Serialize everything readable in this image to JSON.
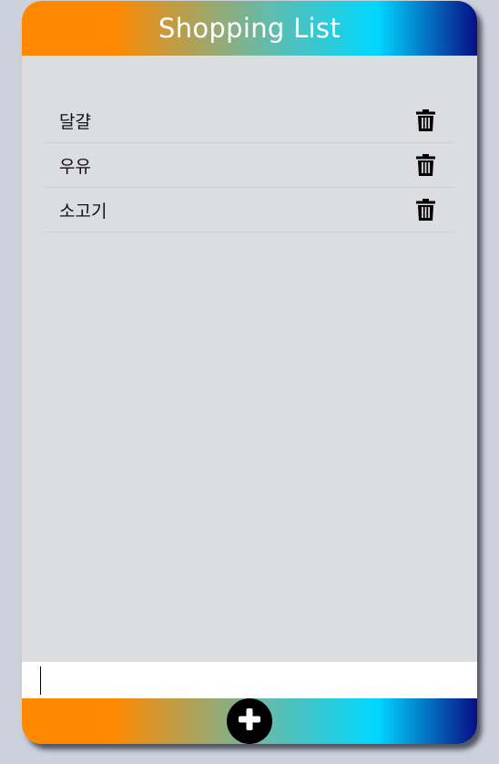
{
  "header": {
    "title": "Shopping List"
  },
  "items": [
    {
      "label": "달걀"
    },
    {
      "label": "우유"
    },
    {
      "label": "소고기"
    }
  ],
  "input": {
    "value": "",
    "placeholder": ""
  },
  "icons": {
    "delete": "trash-icon",
    "add": "plus-icon"
  },
  "colors": {
    "gradient_start": "#ff8800",
    "gradient_mid": "#00d8ff",
    "gradient_end": "#070e85",
    "background": "#dcdde1"
  }
}
